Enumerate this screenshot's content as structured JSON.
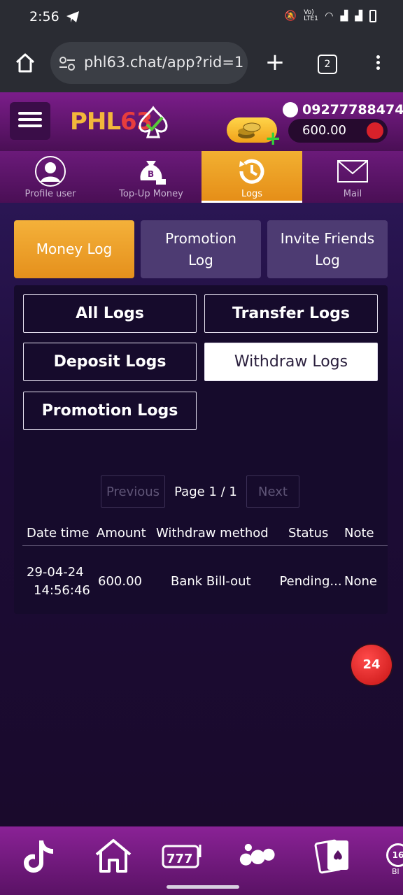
{
  "status_bar": {
    "time": "2:56",
    "signal_label": "Vo) LTE1"
  },
  "browser": {
    "url": "phl63.chat/app?rid=1",
    "tab_count": "2"
  },
  "header": {
    "logo_text_a": "PHL",
    "logo_text_b": "63",
    "phone": "09277788474",
    "balance": "600.00"
  },
  "nav_tabs": [
    {
      "label": "Profile user"
    },
    {
      "label": "Top-Up Money"
    },
    {
      "label": "Logs"
    },
    {
      "label": "Mail"
    }
  ],
  "log_types": [
    {
      "label": "Money Log"
    },
    {
      "label": "Promotion Log"
    },
    {
      "label": "Invite Friends Log"
    }
  ],
  "filters": {
    "all": "All Logs",
    "transfer": "Transfer Logs",
    "deposit": "Deposit Logs",
    "withdraw": "Withdraw Logs",
    "promotion": "Promotion Logs"
  },
  "pager": {
    "previous": "Previous",
    "page": "Page 1 / 1",
    "next": "Next"
  },
  "table": {
    "columns": [
      "Date time",
      "Amount",
      "Withdraw method",
      "Status",
      "Note"
    ],
    "rows": [
      {
        "date": "29-04-24",
        "time": "14:56:46",
        "amount": "600.00",
        "method": "Bank Bill-out",
        "status": "Pending...",
        "note": "None"
      }
    ]
  },
  "support": {
    "label": "24"
  },
  "bottom_nav_partial_label": "Bl",
  "bottom_nav_partial_badge": "16",
  "colors": {
    "accent": "#f2b031",
    "header": "#7b1d8a",
    "panel": "#160b2c"
  }
}
